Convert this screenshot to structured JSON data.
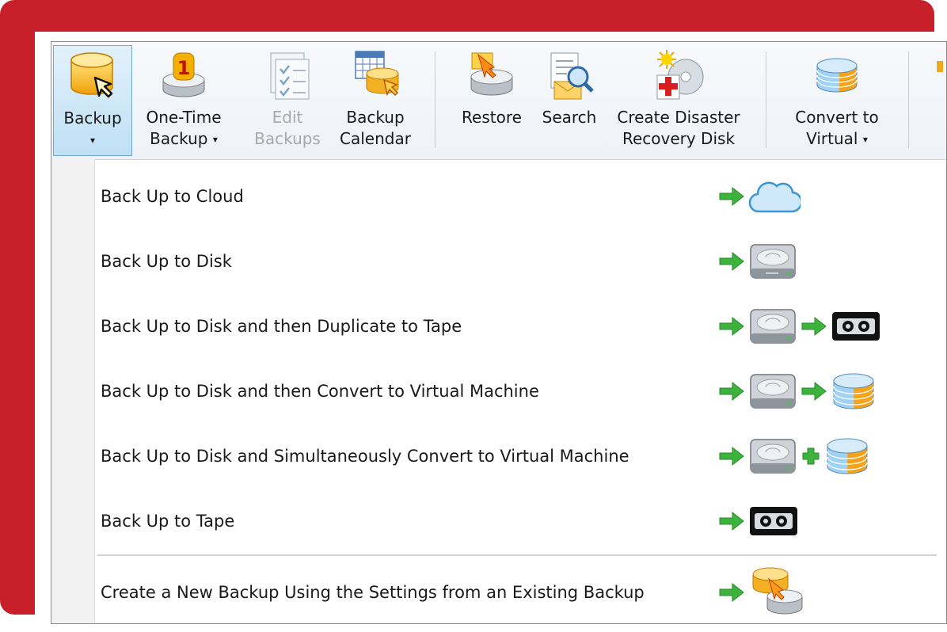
{
  "ribbon": {
    "backup": {
      "label": "Backup",
      "caret": "▾",
      "icon": "backup-database-icon"
    },
    "one_time": {
      "line1": "One-Time",
      "line2": "Backup",
      "caret": "▾",
      "icon": "one-time-backup-icon"
    },
    "edit": {
      "line1": "Edit",
      "line2": "Backups",
      "icon": "edit-backups-icon"
    },
    "calendar": {
      "line1": "Backup",
      "line2": "Calendar",
      "icon": "backup-calendar-icon"
    },
    "restore": {
      "label": "Restore",
      "icon": "restore-icon"
    },
    "search": {
      "label": "Search",
      "icon": "search-icon"
    },
    "disaster": {
      "line1": "Create Disaster",
      "line2": "Recovery Disk",
      "icon": "disaster-recovery-disk-icon"
    },
    "convert": {
      "line1": "Convert to",
      "line2": "Virtual",
      "caret": "▾",
      "icon": "convert-to-virtual-icon"
    }
  },
  "menu": {
    "items": [
      {
        "label": "Back Up to Cloud",
        "icons": [
          "arrow-icon",
          "cloud-icon"
        ]
      },
      {
        "label": "Back Up to Disk",
        "icons": [
          "arrow-icon",
          "disk-icon"
        ]
      },
      {
        "label": "Back Up to Disk and then Duplicate to Tape",
        "icons": [
          "arrow-icon",
          "disk-icon",
          "arrow-icon",
          "tape-icon"
        ]
      },
      {
        "label": "Back Up to Disk and then Convert to Virtual Machine",
        "icons": [
          "arrow-icon",
          "disk-icon",
          "arrow-icon",
          "virtual-machine-icon"
        ]
      },
      {
        "label": "Back Up to Disk and Simultaneously Convert to Virtual Machine",
        "icons": [
          "arrow-icon",
          "disk-icon",
          "plus-icon",
          "virtual-machine-icon"
        ]
      },
      {
        "label": "Back Up to Tape",
        "icons": [
          "arrow-icon",
          "tape-icon"
        ]
      },
      {
        "label": "Create a New Backup Using the Settings from an Existing Backup",
        "icons": [
          "arrow-icon",
          "existing-backup-icon"
        ]
      }
    ]
  },
  "colors": {
    "frame": "#c8202a",
    "arrow": "#3db33d",
    "selected": "#bfe0f5"
  }
}
